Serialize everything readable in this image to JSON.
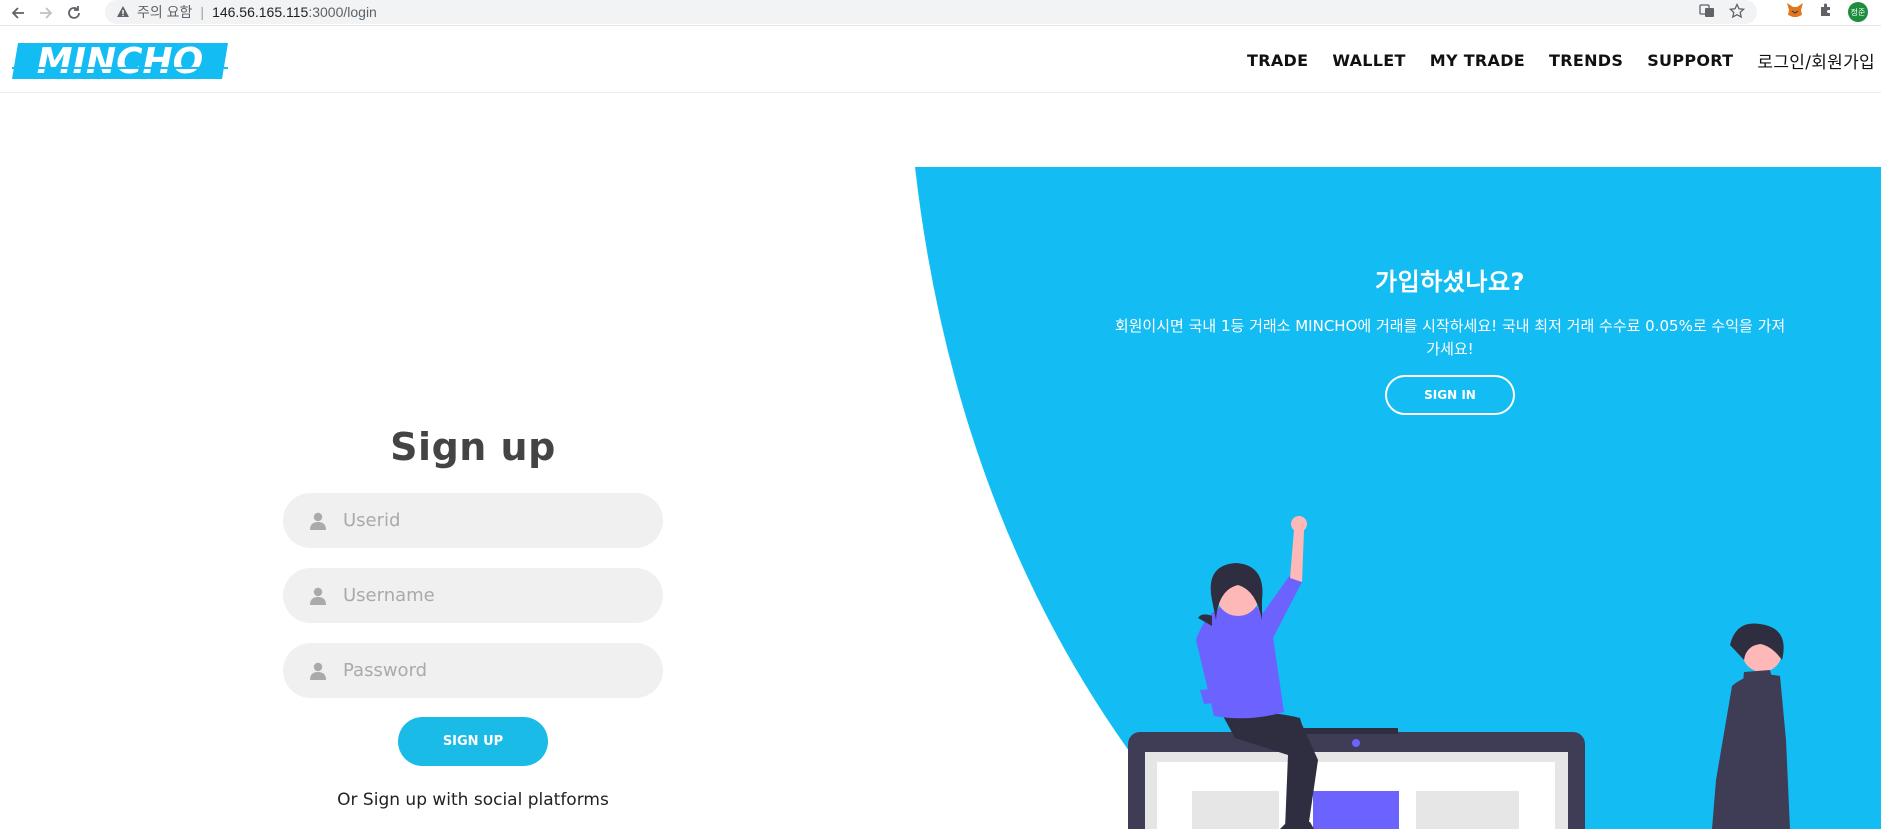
{
  "browser": {
    "security_warning": "주의 요함",
    "url_host": "146.56.165.115",
    "url_path": ":3000/login",
    "avatar_text": "정준"
  },
  "header": {
    "logo_text": "MINCHO",
    "nav": [
      "TRADE",
      "WALLET",
      "MY TRADE",
      "TRENDS",
      "SUPPORT",
      "로그인/회원가입"
    ]
  },
  "panel": {
    "title": "가입하셨나요?",
    "text": "회원이시면 국내 1등 거래소 MINCHO에 거래를 시작하세요! 국내 최저 거래 수수료 0.05%로 수익을 가져가세요!",
    "signin_label": "SIGN IN"
  },
  "signup": {
    "title": "Sign up",
    "fields": [
      {
        "placeholder": "Userid"
      },
      {
        "placeholder": "Username"
      },
      {
        "placeholder": "Password"
      }
    ],
    "button_label": "SIGN UP",
    "social_text": "Or Sign up with social platforms"
  },
  "colors": {
    "accent": "#13bdf3",
    "button": "#1bbbe8",
    "illustration_purple": "#6c63ff",
    "illustration_dark": "#3f3d56"
  }
}
